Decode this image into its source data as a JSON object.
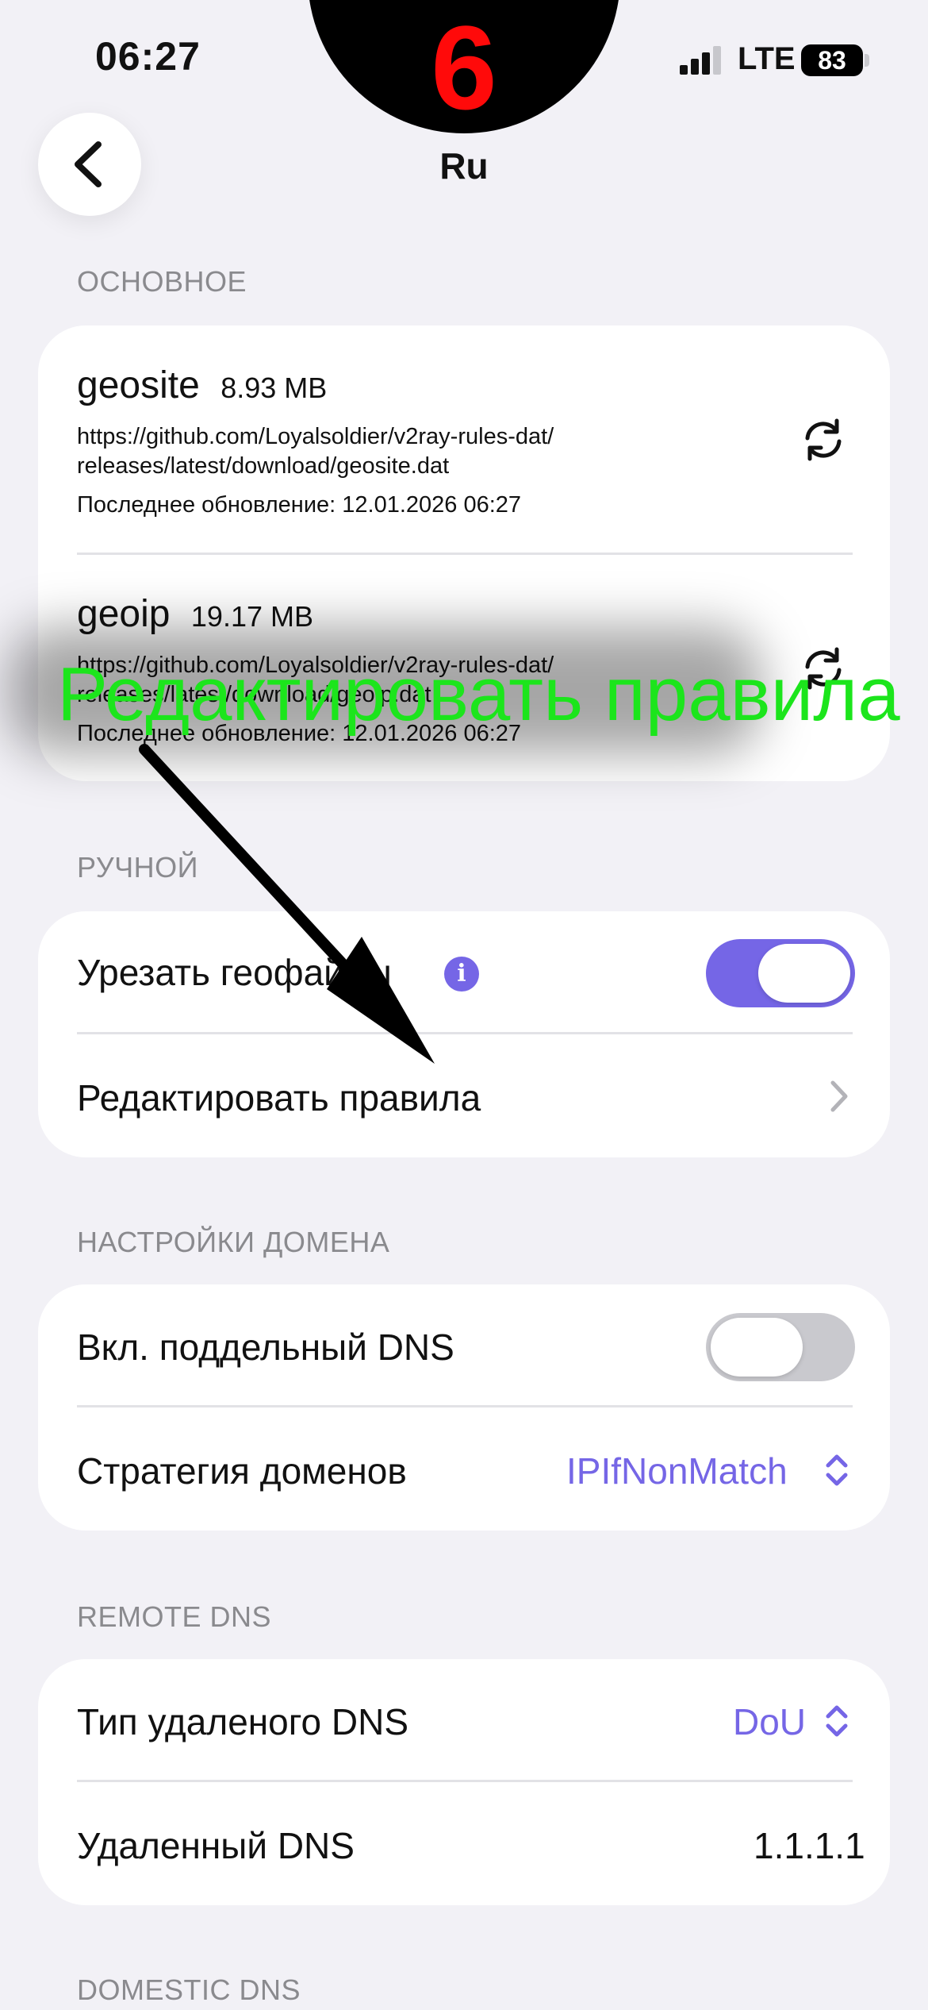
{
  "status_bar": {
    "time": "06:27",
    "network": "LTE",
    "battery": "83"
  },
  "overlay": {
    "step_number": "6",
    "annotation": "Редактировать правила"
  },
  "header": {
    "title": "Ru"
  },
  "sections": {
    "basic": "ОСНОВНОЕ",
    "manual": "РУЧНОЙ",
    "domain": "НАСТРОЙКИ ДОМЕНА",
    "remote_dns": "REMOTE DNS",
    "domestic_dns": "DOMESTIC DNS"
  },
  "files": [
    {
      "name": "geosite",
      "size": "8.93 MB",
      "url_line1": "https://github.com/Loyalsoldier/v2ray-rules-dat/",
      "url_line2": "releases/latest/download/geosite.dat",
      "updated": "Последнее обновление: 12.01.2026 06:27"
    },
    {
      "name": "geoip",
      "size": "19.17 MB",
      "url_line1": "https://github.com/Loyalsoldier/v2ray-rules-dat/",
      "url_line2": "releases/latest/download/geoip.dat",
      "updated": "Последнее обновление: 12.01.2026 06:27"
    }
  ],
  "manual": {
    "trim_label": "Урезать геофайлы",
    "trim_enabled": true,
    "edit_rules_label": "Редактировать правила"
  },
  "domain": {
    "fake_dns_label": "Вкл. поддельный DNS",
    "fake_dns_enabled": false,
    "strategy_label": "Стратегия доменов",
    "strategy_value": "IPIfNonMatch"
  },
  "remote_dns": {
    "type_label": "Тип удаленого DNS",
    "type_value": "DoU",
    "server_label": "Удаленный DNS",
    "server_value": "1.1.1.1"
  },
  "colors": {
    "accent": "#7566e6",
    "background": "#f2f1f6",
    "annotation": "#1ce51c",
    "step_number": "#ff0a0a"
  },
  "icons": {
    "back": "chevron-left-icon",
    "refresh": "refresh-icon",
    "info": "info-icon",
    "row": "chevron-right-icon",
    "select": "chevron-up-down-icon"
  }
}
